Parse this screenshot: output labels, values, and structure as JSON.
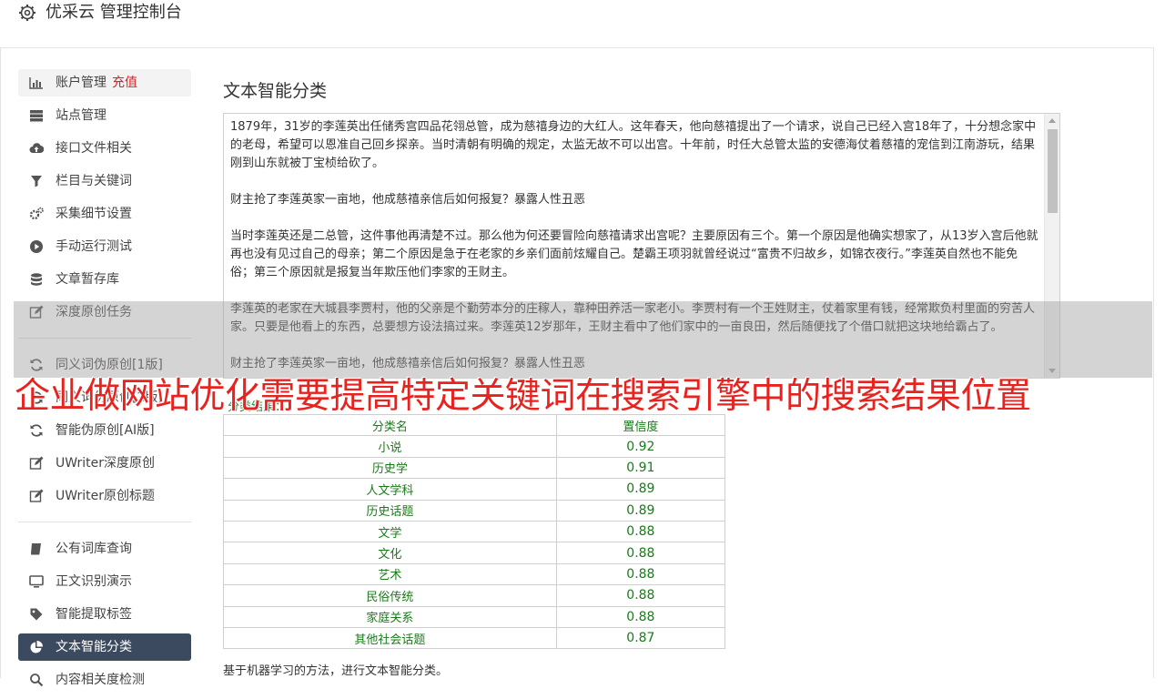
{
  "app": {
    "title": "优采云 管理控制台",
    "icon": "gear-icon"
  },
  "sidebar": {
    "group1": [
      {
        "label": "账户管理",
        "tag": "充值",
        "icon": "bar-chart-icon"
      },
      {
        "label": "站点管理",
        "icon": "server-icon"
      },
      {
        "label": "接口文件相关",
        "icon": "cloud-upload-icon"
      },
      {
        "label": "栏目与关键词",
        "icon": "filter-icon"
      },
      {
        "label": "采集细节设置",
        "icon": "gears-icon"
      },
      {
        "label": "手动运行测试",
        "icon": "play-circle-icon"
      },
      {
        "label": "文章暂存库",
        "icon": "database-icon"
      },
      {
        "label": "深度原创任务",
        "icon": "edit-icon"
      }
    ],
    "group2": [
      {
        "label": "同义词伪原创[1版]",
        "icon": "refresh-icon"
      },
      {
        "label": "同义词伪原创[2版]",
        "icon": "refresh-icon"
      },
      {
        "label": "智能伪原创[AI版]",
        "icon": "refresh-icon"
      },
      {
        "label": "UWriter深度原创",
        "icon": "edit-icon"
      },
      {
        "label": "UWriter原创标题",
        "icon": "edit-icon"
      }
    ],
    "group3": [
      {
        "label": "公有词库查询",
        "icon": "book-icon"
      },
      {
        "label": "正文识别演示",
        "icon": "monitor-icon"
      },
      {
        "label": "智能提取标签",
        "icon": "tag-icon"
      },
      {
        "label": "文本智能分类",
        "icon": "pie-chart-icon",
        "active": true
      },
      {
        "label": "内容相关度检测",
        "icon": "search-icon"
      }
    ]
  },
  "main": {
    "title": "文本智能分类",
    "text_paragraphs": [
      "1879年，31岁的李莲英出任储秀宫四品花翎总管，成为慈禧身边的大红人。这年春天，他向慈禧提出了一个请求，说自己已经入宫18年了，十分想念家中的老母，希望可以恩准自己回乡探亲。当时清朝有明确的规定，太监无故不可以出宫。十年前，时任大总管太监的安德海仗着慈禧的宠信到江南游玩，结果刚到山东就被丁宝桢给砍了。",
      "财主抢了李莲英家一亩地，他成慈禧亲信后如何报复？暴露人性丑恶",
      "当时李莲英还是二总管，这件事他再清楚不过。那么他为何还要冒险向慈禧请求出宫呢？主要原因有三个。第一个原因是他确实想家了，从13岁入宫后他就再也没有见过自己的母亲；第二个原因是急于在老家的乡亲们面前炫耀自己。楚霸王项羽就曾经说过“富贵不归故乡，如锦衣夜行。”李莲英自然也不能免俗；第三个原因就是报复当年欺压他们李家的王财主。",
      "李莲英的老家在大城县李贾村，他的父亲是个勤劳本分的庄稼人，靠种田养活一家老小。李贾村有一个王姓财主，仗着家里有钱，经常欺负村里面的穷苦人家。只要是他看上的东西，总要想方设法搞过来。李莲英12岁那年，王财主看中了他们家中的一亩良田，然后随便找了个借口就把这块地给霸占了。",
      "财主抢了李莲英家一亩地，他成慈禧亲信后如何报复？暴露人性丑恶"
    ],
    "result_label": "分类结果：",
    "table": {
      "headers": [
        "分类名",
        "置信度"
      ],
      "rows": [
        [
          "小说",
          "0.92"
        ],
        [
          "历史学",
          "0.91"
        ],
        [
          "人文学科",
          "0.89"
        ],
        [
          "历史话题",
          "0.89"
        ],
        [
          "文学",
          "0.88"
        ],
        [
          "文化",
          "0.88"
        ],
        [
          "艺术",
          "0.88"
        ],
        [
          "民俗传统",
          "0.88"
        ],
        [
          "家庭关系",
          "0.88"
        ],
        [
          "其他社会话题",
          "0.87"
        ]
      ]
    },
    "footnote": "基于机器学习的方法，进行文本智能分类。"
  },
  "watermark": "企业做网站优化需要提高特定关键词在搜索引擎中的搜索结果位置",
  "colors": {
    "accent_active": "#3c4a60",
    "result_green": "#1a7a1a",
    "watermark_red": "#e8231f",
    "tag_red": "#e02020"
  }
}
